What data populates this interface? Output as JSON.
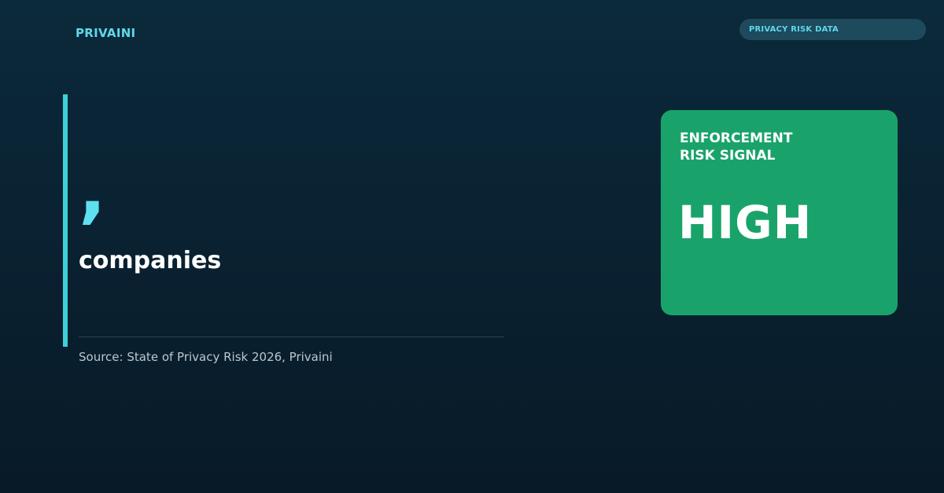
{
  "brand": {
    "name": "PRIVAINI"
  },
  "tag": {
    "label": "PRIVACY RISK DATA"
  },
  "stat": {
    "value": ",",
    "label": "companies",
    "source": "Source: State of Privacy Risk 2026, Privaini"
  },
  "card": {
    "title_line1": "ENFORCEMENT",
    "title_line2": "RISK SIGNAL",
    "value": "HIGH",
    "color": "#19a36a"
  },
  "colors": {
    "accent": "#5fd8ea",
    "background": "#0a2232"
  }
}
